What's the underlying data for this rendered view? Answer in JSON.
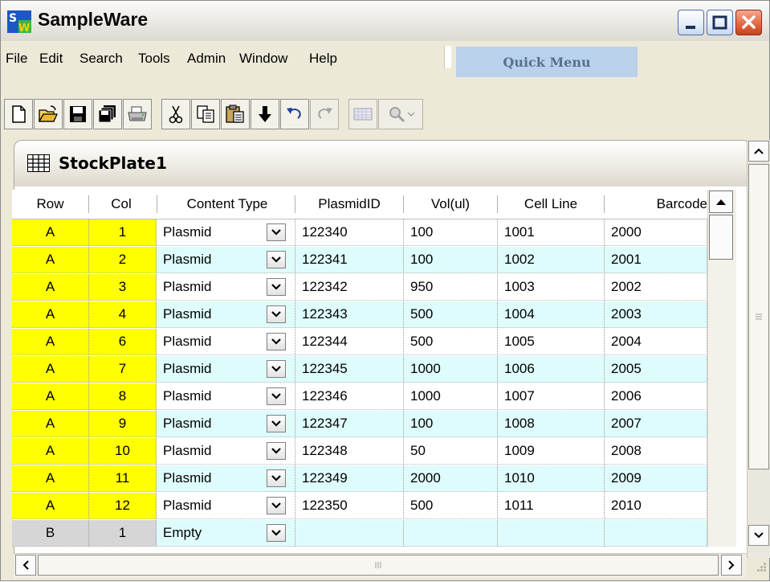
{
  "app": {
    "logo_text": "SW",
    "title": "SampleWare"
  },
  "menu": {
    "items": [
      "File",
      "Edit",
      "Search",
      "Tools",
      "Admin",
      "Window",
      "Help"
    ],
    "quick_menu": "Quick Menu"
  },
  "toolbar": {
    "icons": [
      "new-file",
      "open-folder",
      "save",
      "save-all",
      "print",
      "cut",
      "copy",
      "paste",
      "move-down",
      "undo",
      "redo",
      "grid-view",
      "search-dropdown"
    ]
  },
  "child_window": {
    "title": "StockPlate1"
  },
  "table": {
    "columns": [
      "Row",
      "Col",
      "Content Type",
      "PlasmidID",
      "Vol(ul)",
      "Cell Line",
      "Barcode"
    ],
    "rows": [
      {
        "row": "A",
        "col": "1",
        "type": "Plasmid",
        "plasmid": "122340",
        "vol": "100",
        "cell": "1001",
        "barcode": "2000"
      },
      {
        "row": "A",
        "col": "2",
        "type": "Plasmid",
        "plasmid": "122341",
        "vol": "100",
        "cell": "1002",
        "barcode": "2001"
      },
      {
        "row": "A",
        "col": "3",
        "type": "Plasmid",
        "plasmid": "122342",
        "vol": "950",
        "cell": "1003",
        "barcode": "2002"
      },
      {
        "row": "A",
        "col": "4",
        "type": "Plasmid",
        "plasmid": "122343",
        "vol": "500",
        "cell": "1004",
        "barcode": "2003"
      },
      {
        "row": "A",
        "col": "6",
        "type": "Plasmid",
        "plasmid": "122344",
        "vol": "500",
        "cell": "1005",
        "barcode": "2004"
      },
      {
        "row": "A",
        "col": "7",
        "type": "Plasmid",
        "plasmid": "122345",
        "vol": "1000",
        "cell": "1006",
        "barcode": "2005"
      },
      {
        "row": "A",
        "col": "8",
        "type": "Plasmid",
        "plasmid": "122346",
        "vol": "1000",
        "cell": "1007",
        "barcode": "2006"
      },
      {
        "row": "A",
        "col": "9",
        "type": "Plasmid",
        "plasmid": "122347",
        "vol": "100",
        "cell": "1008",
        "barcode": "2007"
      },
      {
        "row": "A",
        "col": "10",
        "type": "Plasmid",
        "plasmid": "122348",
        "vol": "50",
        "cell": "1009",
        "barcode": "2008"
      },
      {
        "row": "A",
        "col": "11",
        "type": "Plasmid",
        "plasmid": "122349",
        "vol": "2000",
        "cell": "1010",
        "barcode": "2009"
      },
      {
        "row": "A",
        "col": "12",
        "type": "Plasmid",
        "plasmid": "122350",
        "vol": "500",
        "cell": "1011",
        "barcode": "2010"
      },
      {
        "row": "B",
        "col": "1",
        "type": "Empty",
        "plasmid": "",
        "vol": "",
        "cell": "",
        "barcode": ""
      }
    ]
  },
  "colors": {
    "row_highlight": "#ffff00",
    "row_empty": "#d6d6d6",
    "even_row": "#ffffff",
    "odd_row": "#dffcfc",
    "quick_menu_bg": "#b9d1ea"
  }
}
